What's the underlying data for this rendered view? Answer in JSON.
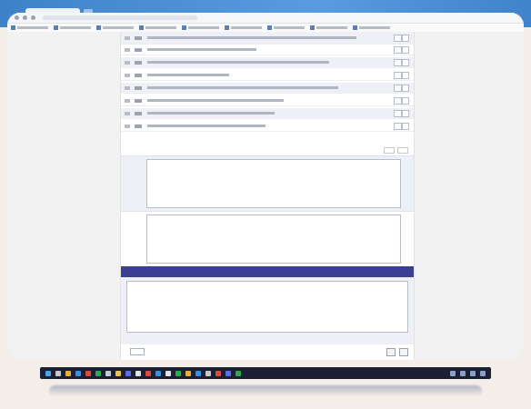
{
  "browser": {
    "tab_label": "",
    "url": ""
  },
  "questions": [
    {
      "num": "",
      "code": ""
    },
    {
      "num": "",
      "code": ""
    },
    {
      "num": "",
      "code": ""
    },
    {
      "num": "",
      "code": ""
    },
    {
      "num": "",
      "code": ""
    },
    {
      "num": "",
      "code": ""
    },
    {
      "num": "",
      "code": ""
    },
    {
      "num": "",
      "code": ""
    }
  ],
  "summary_label": "",
  "textareas": [
    {
      "label": "",
      "value": ""
    },
    {
      "label": "",
      "value": ""
    }
  ],
  "section": {
    "title": "",
    "textarea_value": ""
  },
  "footer": {
    "select_label": "",
    "button1": "",
    "button2": ""
  },
  "below_text": "",
  "colors": {
    "section_bar": "#3b3f94",
    "browser_chrome": "#3d82c9"
  }
}
